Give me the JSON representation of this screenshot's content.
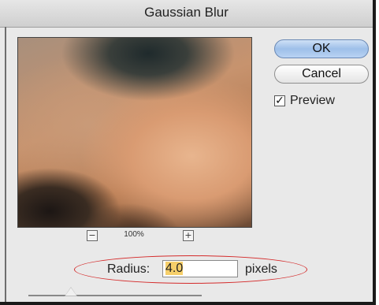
{
  "dialog": {
    "title": "Gaussian Blur",
    "ok_label": "OK",
    "cancel_label": "Cancel",
    "preview_label": "Preview",
    "preview_checked": true,
    "check_glyph": "✓"
  },
  "preview_panel": {
    "zoom_label": "100%",
    "zoom_out_glyph": "−",
    "zoom_in_glyph": "+"
  },
  "radius": {
    "label": "Radius:",
    "value": "4.0",
    "unit": "pixels"
  },
  "slider": {
    "value": 4.0
  },
  "colors": {
    "ok_button": "#9ebfe9",
    "highlight_oval": "#d42a2a",
    "value_selection": "#f6cf6a"
  }
}
